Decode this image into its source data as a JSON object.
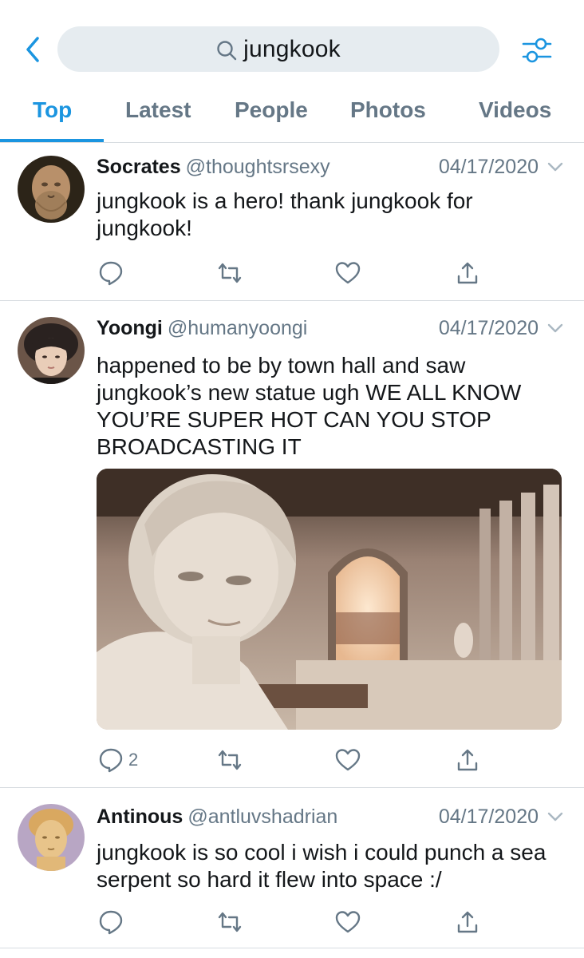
{
  "search": {
    "query": "jungkook"
  },
  "tabs": [
    {
      "label": "Top",
      "active": true
    },
    {
      "label": "Latest",
      "active": false
    },
    {
      "label": "People",
      "active": false
    },
    {
      "label": "Photos",
      "active": false
    },
    {
      "label": "Videos",
      "active": false
    }
  ],
  "tweets": [
    {
      "name": "Socrates",
      "handle": "@thoughtsrsexy",
      "date": "04/17/2020",
      "text_lines": [
        "jungkook is a hero! thank jungkook for",
        "jungkook!"
      ],
      "reply_count": ""
    },
    {
      "name": "Yoongi",
      "handle": "@humanyoongi",
      "date": "04/17/2020",
      "text_lines": [
        "happened to be by town hall and saw",
        "jungkook’s new statue ugh WE ALL KNOW",
        "YOU’RE SUPER HOT CAN YOU STOP",
        "BROADCASTING IT"
      ],
      "reply_count": "2"
    },
    {
      "name": "Antinous",
      "handle": "@antluvshadrian",
      "date": "04/17/2020",
      "text_lines": [
        "jungkook is so cool i wish i could punch a sea",
        "serpent so hard it flew into space :/"
      ],
      "reply_count": ""
    }
  ],
  "colors": {
    "accent": "#1b95e0",
    "muted": "#657786",
    "search_bg": "#e6ecf0",
    "divider": "#d8dde1"
  }
}
